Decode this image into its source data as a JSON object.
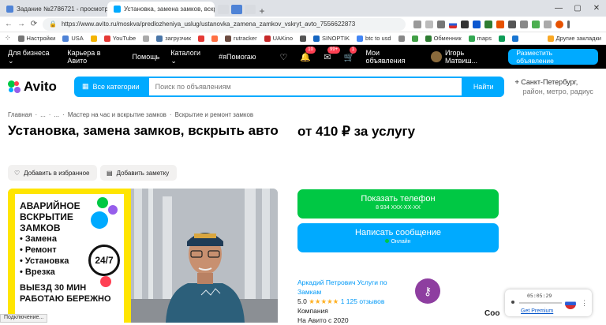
{
  "browser": {
    "tabs": [
      {
        "label": "Задание №2786721 - просмотр з",
        "color": "#4f83d6",
        "active": false
      },
      {
        "label": "Установка, замена замков, вскры",
        "color": "#00aaff",
        "active": true
      }
    ],
    "url": "https://www.avito.ru/moskva/predlozheniya_uslug/ustanovka_zamena_zamkov_vskryt_avto_7556622873",
    "bookmarks": [
      "Настройки",
      "USA",
      "",
      "YouTube",
      "",
      "загрузчик",
      "",
      "",
      "rutracker",
      "UAKino",
      "",
      "SINOPTIK",
      "btc to usd",
      "",
      "",
      "Обменник",
      "maps",
      "",
      "",
      ""
    ],
    "bookmarks_right": "Другие закладки"
  },
  "topnav": {
    "items": [
      "Для бизнеса",
      "Карьера в Авито",
      "Помощь",
      "Каталоги",
      "#яПомогаю"
    ],
    "badges": [
      "10",
      "99+",
      "1"
    ],
    "my_ads": "Мои объявления",
    "user": "Игорь Матвиш...",
    "place_ad": "Разместить объявление"
  },
  "search": {
    "logo": "Avito",
    "categories": "Все категории",
    "placeholder": "Поиск по объявлениям",
    "button": "Найти",
    "city": "Санкт-Петербург,",
    "city_sub": "район, метро, радиус"
  },
  "breadcrumbs": [
    "Главная",
    "·",
    "...",
    "·",
    "...",
    "·",
    "Мастер на час и вскрытие замков",
    "·",
    "Вскрытие и ремонт замков"
  ],
  "listing": {
    "title": "Установка, замена замков, вскрыть авто",
    "price": "от 410 ₽ за услугу",
    "favorite": "Добавить в избранное",
    "note": "Добавить заметку"
  },
  "flyer": {
    "lines": [
      "АВАРИЙНОЕ",
      "ВСКРЫТИЕ",
      "ЗАМКОВ",
      "• Замена",
      "• Ремонт",
      "• Установка",
      "• Врезка",
      "ВЫЕЗД 30 МИН",
      "РАБОТАЮ БЕРЕЖНО"
    ],
    "badge": "24/7"
  },
  "contact": {
    "call": "Показать телефон",
    "phone": "8 934 XXX-XX-XX",
    "message": "Написать сообщение",
    "online": "Онлайн"
  },
  "seller": {
    "name": "Аркадий Петрович Услуги по Замкам",
    "rating": "5.0",
    "stars": "★★★★★",
    "reviews": "1 125 отзывов",
    "type": "Компания",
    "since": "На Авито с 2020"
  },
  "status_bar": "Подключение...",
  "widget": {
    "time": "05:05:29",
    "link": "Get Premium"
  },
  "cut_text": "Соо"
}
